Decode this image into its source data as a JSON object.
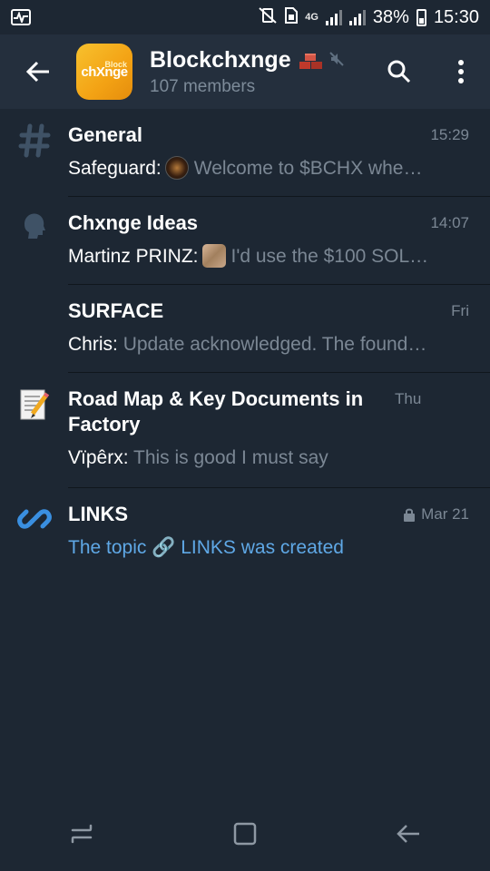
{
  "status_bar": {
    "battery_percent": "38%",
    "time": "15:30",
    "network": "4G"
  },
  "header": {
    "title": "Blockchxnge",
    "members": "107 members",
    "avatar_text": "chXnge",
    "avatar_tag": "Block"
  },
  "topics": [
    {
      "name": "General",
      "time": "15:29",
      "sender": "Safeguard:",
      "message": "Welcome to $BCHX   whe…",
      "icon": "hash-icon"
    },
    {
      "name": "Chxnge Ideas",
      "time": "14:07",
      "sender": "Martinz PRINZ:",
      "message": "I'd use the $100 SOL…",
      "icon": "speaking-head-icon"
    },
    {
      "name": "SURFACE",
      "time": "Fri",
      "sender": "Chris:",
      "message": "Update acknowledged. The found…",
      "icon": "none"
    },
    {
      "name": "Road Map & Key Documents in Factory",
      "time": "Thu",
      "sender": "Vïpêrx:",
      "message": "This is good I must say",
      "icon": "memo-icon"
    },
    {
      "name": "LINKS",
      "time": "Mar 21",
      "sender": "",
      "message": "The topic 🔗 LINKS was created",
      "icon": "link-icon",
      "locked": true
    }
  ],
  "colors": {
    "background": "#1d2733",
    "header": "#242f3d",
    "accent": "#5fa8e6",
    "muted": "#7b8794"
  }
}
